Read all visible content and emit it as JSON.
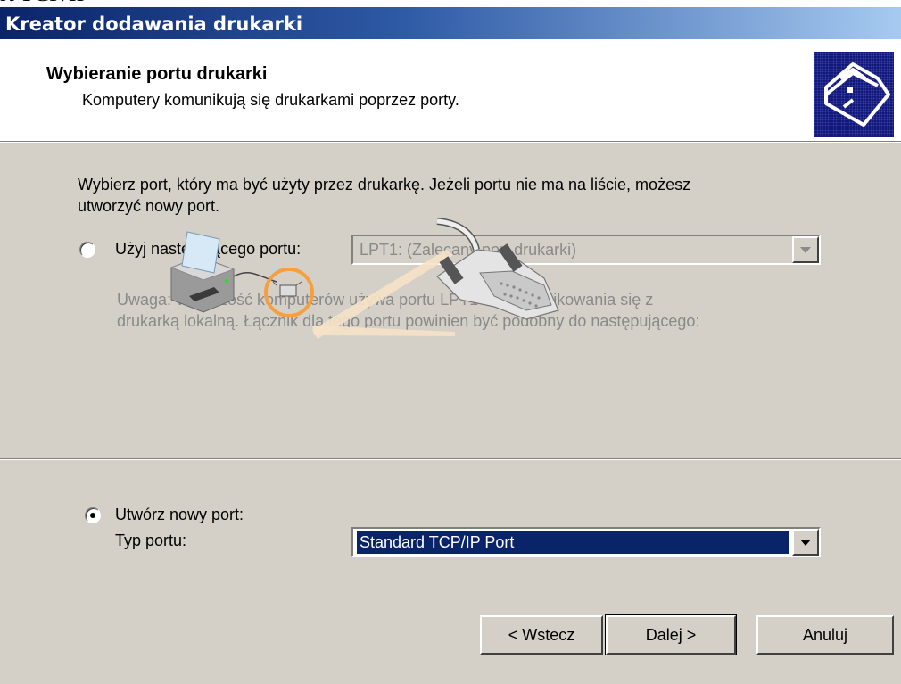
{
  "background_text": "rt TCP/IP",
  "window": {
    "title": "Kreator dodawania drukarki"
  },
  "header": {
    "title": "Wybieranie portu drukarki",
    "subtitle": "Komputery komunikują się drukarkami poprzez porty.",
    "icon": "printer-wizard-icon"
  },
  "body": {
    "intro_line1": "Wybierz port, który ma być użyty przez drukarkę. Jeżeli portu nie ma na liście, możesz",
    "intro_line2": "utworzyć nowy port.",
    "option_existing": {
      "label": "Użyj następującego portu:",
      "selected": false,
      "value": "LPT1: (Zalecany port drukarki)",
      "enabled": false
    },
    "note_line1": "Uwaga: Większość komputerów używa portu LPT1 do komunikowania się z",
    "note_line2": "drukarką lokalną. Łącznik dla tego portu powinien być podobny do następującego:",
    "option_new": {
      "label": "Utwórz nowy port:",
      "selected": true,
      "type_label": "Typ portu:",
      "value": "Standard TCP/IP Port"
    }
  },
  "footer": {
    "back": "< Wstecz",
    "next": "Dalej >",
    "cancel": "Anuluj"
  },
  "colors": {
    "titlebar_start": "#0a246a",
    "titlebar_end": "#a6caf0",
    "dialog_bg": "#d4d0c8",
    "highlight": "#0a246a",
    "connector_accent": "#f5a040"
  }
}
